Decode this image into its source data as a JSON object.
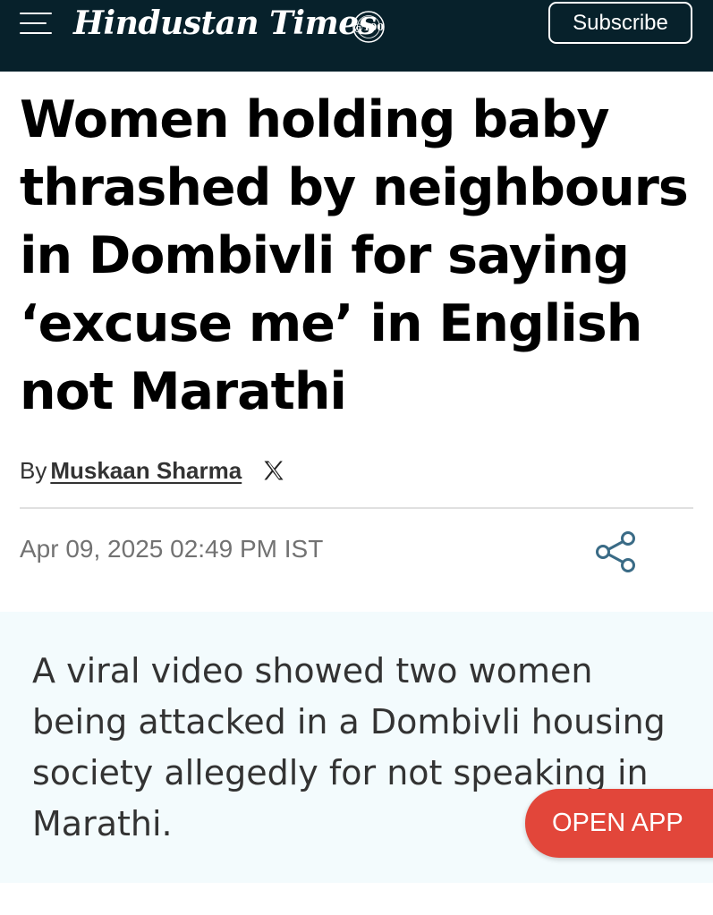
{
  "header": {
    "logo_text": "Hindustan Times",
    "logo_badge": "@100",
    "subscribe_label": "Subscribe",
    "background_color": "#07212b"
  },
  "article": {
    "headline": "Women holding baby thrashed by neighbours in Dombivli for saying ‘excuse me’ in English not Marathi",
    "byline_prefix": "By",
    "author": "Muskaan Sharma",
    "date": "Apr 09, 2025 02:49 PM IST",
    "summary": "A viral video showed two women being attacked in a Dombivli housing society allegedly for not speaking in Marathi."
  },
  "open_app": {
    "label": "OPEN APP",
    "color": "#e2463a"
  },
  "icons": {
    "menu": "hamburger-menu-icon",
    "author_social": "x-twitter-icon",
    "share": "share-icon"
  }
}
